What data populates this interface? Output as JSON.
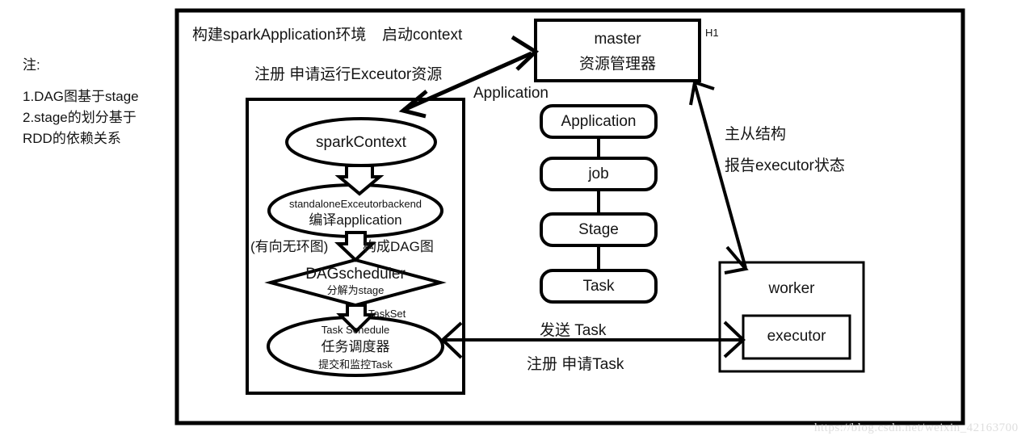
{
  "page": {
    "background_color": "#ffffff",
    "stroke_color": "#000000",
    "text_color": "#141414",
    "watermark": "https://blog.csdn.net/weixin_42163700"
  },
  "notes": {
    "title": "注:",
    "line1": "1.DAG图基于stage",
    "line2": "2.stage的划分基于",
    "line3": "RDD的依赖关系"
  },
  "headings": {
    "build_env": "构建sparkApplication环境",
    "start_context": "启动context",
    "register_request": "注册 申请运行Exceutor资源"
  },
  "nodes": {
    "master": {
      "title": "master",
      "subtitle": "资源管理器",
      "tag": "H1"
    },
    "spark_context": {
      "label": "sparkContext"
    },
    "backend": {
      "line1": "standaloneExceutorbackend",
      "line2": "编译application"
    },
    "dag_scheduler": {
      "label": "DAGscheduler",
      "sublabel": "分解为stage"
    },
    "task_schedule": {
      "line1": "Task Schedule",
      "line2": "任务调度器",
      "line3": "提交和监控Task"
    },
    "worker": {
      "label": "worker",
      "executor": "executor"
    },
    "pipeline": [
      {
        "label": "Application"
      },
      {
        "label": "job"
      },
      {
        "label": "Stage"
      },
      {
        "label": "Task"
      }
    ]
  },
  "edge_labels": {
    "application": "Application",
    "dag_left": "(有向无环图)",
    "dag_right": "构成DAG图",
    "task_set": "TaskSet",
    "send_task": "发送 Task",
    "register_task": "注册 申请Task",
    "master_slave": "主从结构",
    "report_executor": "报告executor状态"
  }
}
